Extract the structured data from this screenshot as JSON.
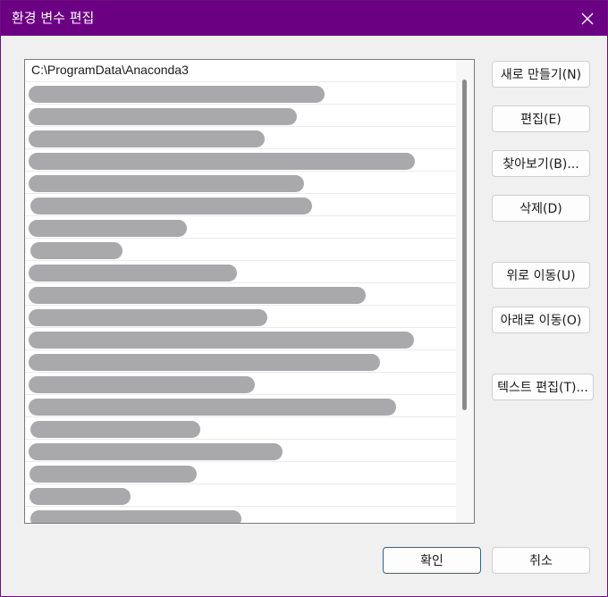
{
  "window": {
    "title": "환경 변수 편집"
  },
  "list": {
    "first_item": "C:\\ProgramData\\Anaconda3"
  },
  "buttons": {
    "new": "새로 만들기(N)",
    "edit": "편집(E)",
    "browse": "찾아보기(B)...",
    "delete": "삭제(D)",
    "move_up": "위로 이동(U)",
    "move_down": "아래로 이동(O)",
    "edit_text": "텍스트 편집(T)...",
    "ok": "확인",
    "cancel": "취소"
  },
  "colors": {
    "titlebar": "#6b0083",
    "redaction": "#a9a9ac"
  }
}
